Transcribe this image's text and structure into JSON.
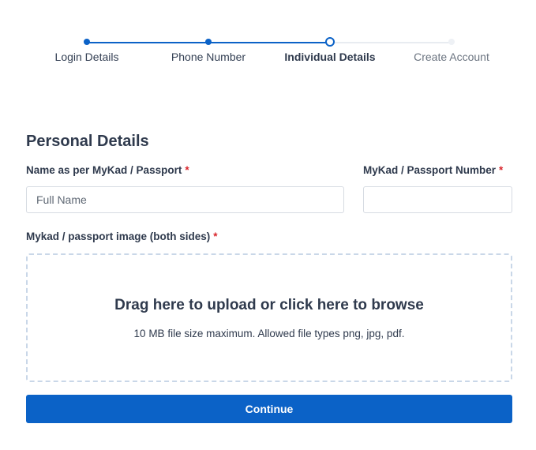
{
  "stepper": {
    "steps": [
      {
        "label": "Login Details",
        "state": "done"
      },
      {
        "label": "Phone Number",
        "state": "done"
      },
      {
        "label": "Individual Details",
        "state": "current"
      },
      {
        "label": "Create Account",
        "state": "pending"
      }
    ],
    "colors": {
      "active": "#0b62c7",
      "inactive": "#e8ecf1"
    }
  },
  "form": {
    "section_title": "Personal Details",
    "name_field": {
      "label": "Name as per MyKad / Passport",
      "required_mark": "*",
      "placeholder": "Full Name",
      "value": ""
    },
    "id_field": {
      "label": "MyKad / Passport Number",
      "required_mark": "*",
      "placeholder": "",
      "value": ""
    },
    "upload": {
      "label": "Mykad / passport image (both sides)",
      "required_mark": "*",
      "title": "Drag here to upload or click here to browse",
      "hint": "10 MB file size maximum. Allowed file types png, jpg, pdf."
    },
    "continue_label": "Continue"
  }
}
